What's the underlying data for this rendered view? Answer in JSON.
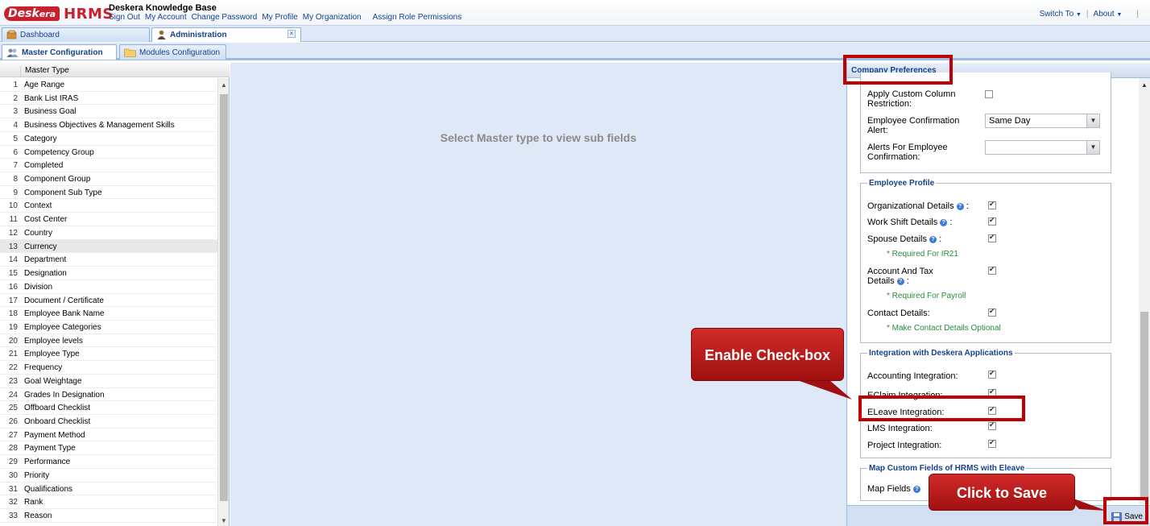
{
  "header": {
    "logo_desk": "Desk",
    "logo_era": "era",
    "logo_hrms": "HRMS",
    "kb_title": "Deskera Knowledge Base",
    "links": [
      "Sign Out",
      "My Account",
      "Change Password",
      "My Profile",
      "My Organization",
      "Assign Role Permissions"
    ],
    "switch_to": "Switch To",
    "about": "About"
  },
  "tabs": {
    "dashboard": "Dashboard",
    "administration": "Administration",
    "master_configuration": "Master Configuration",
    "modules_configuration": "Modules Configuration"
  },
  "grid": {
    "header": "Master Type",
    "rows": [
      "Age Range",
      "Bank List IRAS",
      "Business Goal",
      "Business Objectives & Management Skills",
      "Category",
      "Competency Group",
      "Completed",
      "Component Group",
      "Component Sub Type",
      "Context",
      "Cost Center",
      "Country",
      "Currency",
      "Department",
      "Designation",
      "Division",
      "Document / Certificate",
      "Employee Bank Name",
      "Employee Categories",
      "Employee levels",
      "Employee Type",
      "Frequency",
      "Goal Weightage",
      "Grades In Designation",
      "Offboard Checklist",
      "Onboard Checklist",
      "Payment Method",
      "Payment Type",
      "Performance",
      "Priority",
      "Qualifications",
      "Rank",
      "Reason"
    ],
    "selected_index": 13
  },
  "center": {
    "message": "Select Master type to view sub fields"
  },
  "preferences": {
    "title": "Company Preferences",
    "apply_custom_column": "Apply Custom Column Restriction:",
    "employee_confirmation_alert": "Employee Confirmation Alert:",
    "employee_confirmation_alert_value": "Same Day",
    "alerts_for_employee_confirmation": "Alerts For Employee Confirmation:",
    "alerts_for_employee_confirmation_value": "",
    "employee_profile": {
      "legend": "Employee Profile",
      "organizational": "Organizational Details",
      "work_shift": "Work Shift Details",
      "spouse": "Spouse Details",
      "spouse_note": "* Required For IR21",
      "account_tax_1": "Account And Tax",
      "account_tax_2": "Details",
      "account_note": "* Required For Payroll",
      "contact": "Contact Details:",
      "contact_note": "* Make Contact Details Optional",
      "colon": ":"
    },
    "integration": {
      "legend": "Integration with Deskera Applications",
      "accounting": "Accounting Integration:",
      "eclaim": "EClaim Integration:",
      "eleave": "ELeave Integration:",
      "lms": "LMS Integration:",
      "project": "Project Integration:"
    },
    "map_fields": {
      "legend": "Map Custom Fields of HRMS with Eleave",
      "label": "Map Fields"
    },
    "save": "Save"
  },
  "callouts": {
    "enable_checkbox": "Enable Check-box",
    "click_to_save": "Click to Save"
  },
  "colors": {
    "brand_red": "#c8202d",
    "link_blue": "#15428b",
    "highlight_red": "#c00000",
    "note_green": "#2a8a3a"
  }
}
